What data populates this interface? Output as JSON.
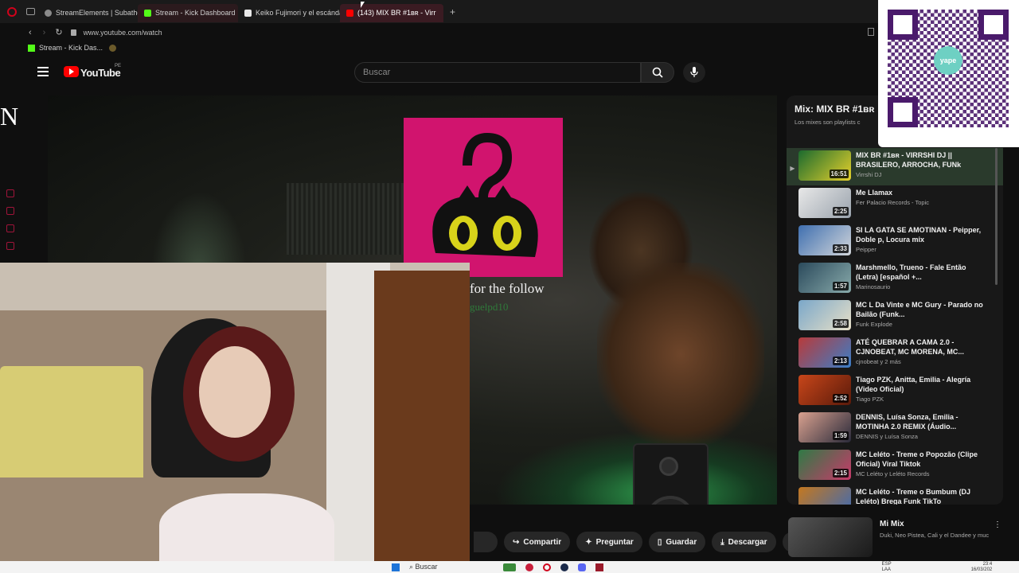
{
  "browser": {
    "tabs": [
      {
        "label": "StreamElements | Subathon",
        "color": "#8a8a8a"
      },
      {
        "label": "Stream - Kick Dashboard",
        "color": "#53fc18"
      },
      {
        "label": "Keiko Fujimori y el escándalo",
        "color": "#e8e8e8"
      },
      {
        "label": "(143) MIX BR #1ʙʀ - Virr",
        "color": "#ff0000"
      }
    ],
    "url": "www.youtube.com/watch",
    "bookmark": "Stream - Kick Das..."
  },
  "youtube": {
    "logo": "YouTube",
    "country": "PE",
    "search_placeholder": "Buscar"
  },
  "overlay": {
    "left_letter": "N",
    "follow_text": "for the follow",
    "follow_user": "guelpd10"
  },
  "playlist": {
    "title": "Mix: MIX BR #1ʙʀ",
    "subtitle": "Los mixes son playlists c",
    "items": [
      {
        "title": "MIX BR #1ʙʀ - VIRRSHI DJ || BRASILERO, ARROCHA, FUNk",
        "channel": "Virrshi DJ",
        "duration": "16:51",
        "thumb": "#1b6a2e"
      },
      {
        "title": "Me Llamax",
        "channel": "Fer Palacio Records - Topic",
        "duration": "2:25",
        "thumb": "#9aa3ad"
      },
      {
        "title": "SI LA GATA SE AMOTINAN - Peipper, Doble p, Locura mix",
        "channel": "Peipper",
        "duration": "2:33",
        "thumb": "#3f6fb0"
      },
      {
        "title": "Marshmello, Trueno - Fale Então (Letra) [español +...",
        "channel": "Marinosaurio",
        "duration": "1:57",
        "thumb": "#2b4a5c"
      },
      {
        "title": "MC L Da Vinte e MC Gury - Parado no Bailão (Funk...",
        "channel": "Funk Explode",
        "duration": "2:58",
        "thumb": "#7aa7c9"
      },
      {
        "title": "ATÉ QUEBRAR A CAMA 2.0 - CJNOBEAT, MC MORENA, MC...",
        "channel": "cjnobeat y 2 más",
        "duration": "2:13",
        "thumb": "#b83a3a"
      },
      {
        "title": "Tiago PZK, Anitta, Emilia - Alegría (Video Oficial)",
        "channel": "Tiago PZK",
        "duration": "2:52",
        "thumb": "#c8461a"
      },
      {
        "title": "DENNIS, Luísa Sonza, Emilia - MOTINHA 2.0 REMIX (Áudio...",
        "channel": "DENNIS y Luísa Sonza",
        "duration": "1:59",
        "thumb": "#d9a18f"
      },
      {
        "title": "MC Leléto - Treme o Popozão (Clipe Oficial) Viral Tiktok",
        "channel": "MC Leléto y Leléto Records",
        "duration": "2:15",
        "thumb": "#2f7a45"
      },
      {
        "title": "MC Leléto - Treme o Bumbum (DJ Leléto) Brega Funk TikTo",
        "channel": "",
        "duration": "",
        "thumb": "#c4781f"
      }
    ]
  },
  "actions": [
    {
      "label": "Compartir",
      "icon": "share-icon"
    },
    {
      "label": "Preguntar",
      "icon": "sparkle-icon"
    },
    {
      "label": "Guardar",
      "icon": "bookmark-icon"
    },
    {
      "label": "Descargar",
      "icon": "download-icon"
    }
  ],
  "mix_card": {
    "title": "Mi Mix",
    "subtitle": "Duki, Neo Pistea, Cali y el Dandee y muc"
  },
  "taskbar": {
    "search": "Buscar",
    "lang": "ESP",
    "lang2": "LAA",
    "time": "23:4",
    "date": "16/03/202"
  },
  "qr": {
    "brand": "yape"
  }
}
